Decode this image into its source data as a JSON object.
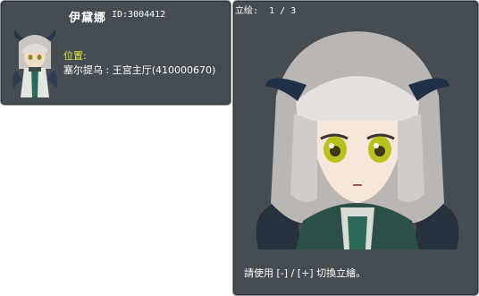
{
  "npc_info": {
    "name": "伊黛娜",
    "id_text": "ID:3004412",
    "location_label": "位置:",
    "location_value": "塞尔提乌 : 王宫主厅(410000670)"
  },
  "portrait": {
    "header_label": "立绘:",
    "counter": "1 / 3",
    "instructions_prefix": "請使用",
    "key_prev": "[-]",
    "separator": "/",
    "key_next": "[+]",
    "instructions_suffix": "切換立繪。"
  },
  "colors": {
    "panel_bg": "#454c52",
    "panel_border": "#8a9096",
    "location_label": "#d8e83a",
    "text": "#ffffff"
  }
}
